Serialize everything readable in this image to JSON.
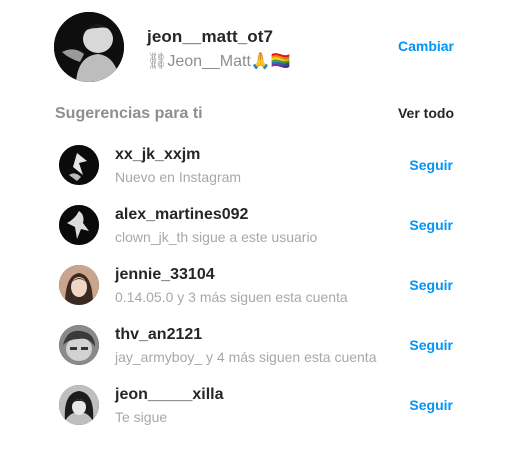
{
  "profile": {
    "username": "jeon__matt_ot7",
    "full_name": "⛓Jeon__Matt🙏🏳️‍🌈",
    "switch_label": "Cambiar"
  },
  "suggestions": {
    "title": "Sugerencias para ti",
    "see_all_label": "Ver todo",
    "items": [
      {
        "username": "xx_jk_xxjm",
        "subtitle": "Nuevo en Instagram",
        "follow_label": "Seguir"
      },
      {
        "username": "alex_martines092",
        "subtitle": "clown_jk_th sigue a este usuario",
        "follow_label": "Seguir"
      },
      {
        "username": "jennie_33104",
        "subtitle": "0.14.05.0 y 3 más siguen esta cuenta",
        "follow_label": "Seguir"
      },
      {
        "username": "thv_an2121",
        "subtitle": "jay_armyboy_ y 4 más siguen esta cuenta",
        "follow_label": "Seguir"
      },
      {
        "username": "jeon_____xilla",
        "subtitle": "Te sigue",
        "follow_label": "Seguir"
      }
    ]
  },
  "colors": {
    "link_blue": "#0095f6",
    "primary_text": "#262626",
    "secondary_text": "#8e8e8e"
  }
}
